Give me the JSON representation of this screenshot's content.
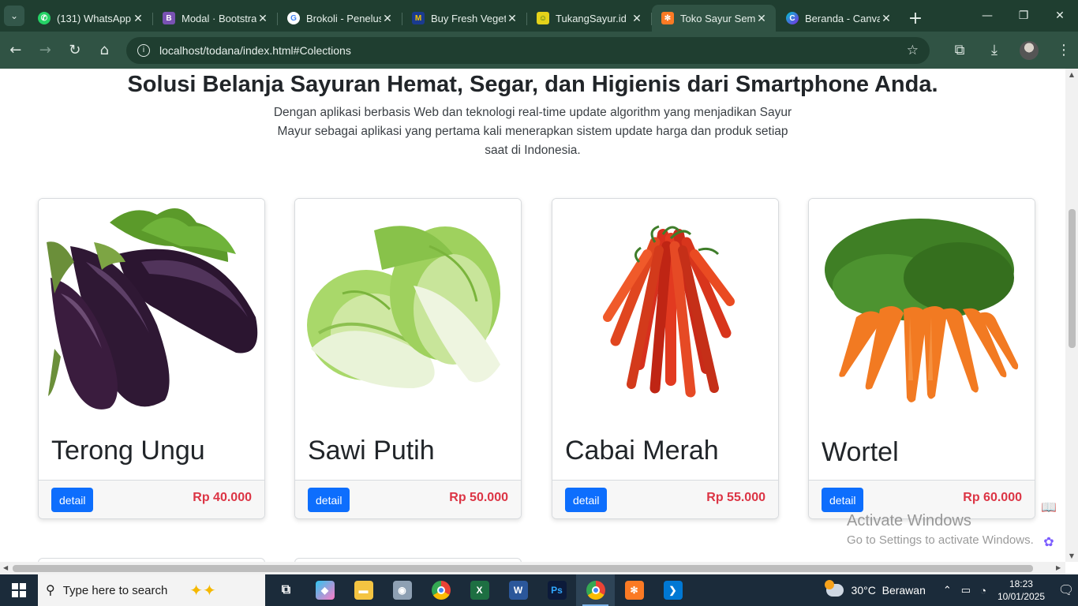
{
  "browser": {
    "tabs": [
      {
        "title": "(131) WhatsApp",
        "favicon": "whatsapp-icon",
        "color": "#25d366",
        "active": false
      },
      {
        "title": "Modal · Bootstrap",
        "favicon": "bootstrap-icon",
        "color": "#7952b3",
        "active": false
      },
      {
        "title": "Brokoli - Penelusuran",
        "favicon": "google-icon",
        "color": "#ffffff",
        "active": false
      },
      {
        "title": "Buy Fresh Vegetables",
        "favicon": "m-icon",
        "color": "#1a3b8f",
        "active": false
      },
      {
        "title": "TukangSayur.id",
        "favicon": "tukangsayur-icon",
        "color": "#e4d21a",
        "active": false
      },
      {
        "title": "Toko Sayur Semua",
        "favicon": "xampp-icon",
        "color": "#fb7a24",
        "active": true
      },
      {
        "title": "Beranda - Canva",
        "favicon": "canva-icon",
        "color": "#3b82f6",
        "active": false
      }
    ],
    "url": "localhost/todana/index.html#Colections"
  },
  "page": {
    "heading": "Solusi Belanja Sayuran Hemat, Segar, dan Higienis dari Smartphone Anda.",
    "lead": "Dengan aplikasi berbasis Web dan teknologi real-time update algorithm yang menjadikan Sayur Mayur sebagai aplikasi yang pertama kali menerapkan sistem update harga dan produk setiap saat di Indonesia.",
    "products": [
      {
        "name": "Terong Ungu",
        "price": "Rp 40.000",
        "button": "detail",
        "image": "eggplant"
      },
      {
        "name": "Sawi Putih",
        "price": "Rp 50.000",
        "button": "detail",
        "image": "napa-cabbage"
      },
      {
        "name": "Cabai Merah",
        "price": "Rp 55.000",
        "button": "detail",
        "image": "red-chili"
      },
      {
        "name": "Wortel",
        "price": "Rp 60.000",
        "button": "detail",
        "image": "carrot"
      }
    ],
    "watermark": {
      "line1": "Activate Windows",
      "line2": "Go to Settings to activate Windows."
    }
  },
  "taskbar": {
    "search_placeholder": "Type here to search",
    "temperature": "30°C",
    "weather": "Berawan",
    "time": "18:23",
    "date": "10/01/2025"
  },
  "colors": {
    "accent": "#0d6efd",
    "price": "#dc3545",
    "chrome": "#305344"
  }
}
